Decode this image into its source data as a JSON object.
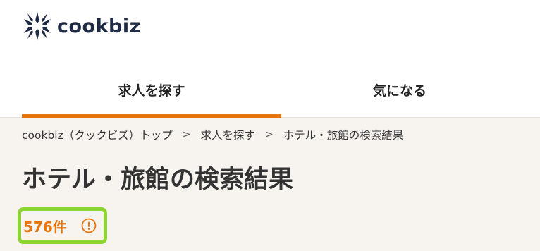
{
  "logo": {
    "text": "cookbiz"
  },
  "tabs": [
    {
      "label": "求人を探す",
      "active": true
    },
    {
      "label": "気になる",
      "active": false
    }
  ],
  "breadcrumb": [
    "cookbiz（クックビズ）トップ",
    "求人を探す",
    "ホテル・旅館の検索結果"
  ],
  "breadcrumb_separator": ">",
  "title": "ホテル・旅館の検索結果",
  "results": {
    "count_label": "576件",
    "info_icon": "info-icon"
  },
  "colors": {
    "accent": "#e8740c",
    "highlight": "#8ed433",
    "brand": "#1f2a44",
    "background": "#f7f4f0"
  }
}
